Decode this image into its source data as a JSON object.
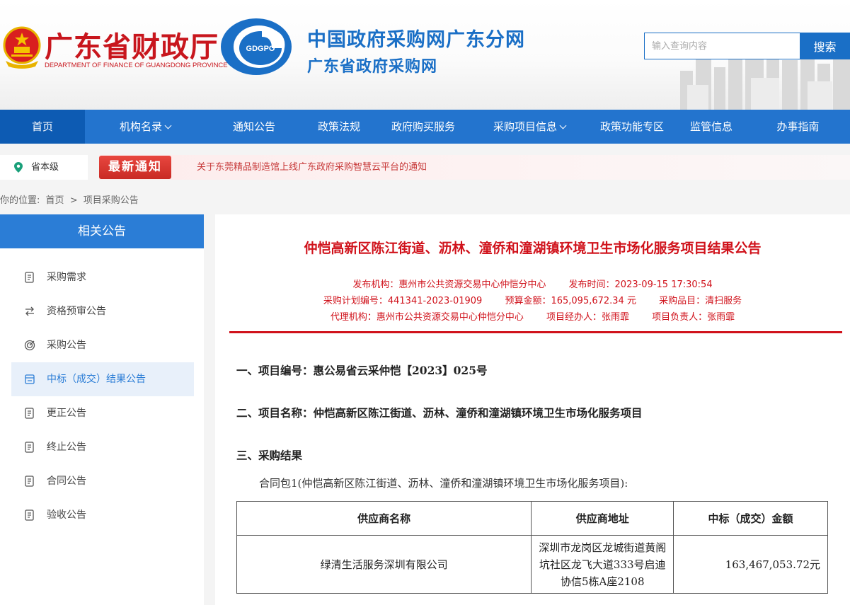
{
  "header": {
    "dept_name": "广东省财政厅",
    "dept_name_en": "DEPARTMENT OF FINANCE OF GUANGDONG PROVINCE",
    "logo_text": "GDGPO",
    "site_title": "中国政府采购网广东分网",
    "site_subtitle": "广东省政府采购网",
    "search": {
      "placeholder": "输入查询内容",
      "button_label": "搜索"
    }
  },
  "nav": {
    "items": [
      {
        "label": "首页",
        "active": true,
        "dropdown": false
      },
      {
        "label": "机构名录",
        "active": false,
        "dropdown": true
      },
      {
        "label": "通知公告",
        "active": false,
        "dropdown": false
      },
      {
        "label": "政策法规",
        "active": false,
        "dropdown": false
      },
      {
        "label": "政府购买服务",
        "active": false,
        "dropdown": false
      },
      {
        "label": "采购项目信息",
        "active": false,
        "dropdown": true
      },
      {
        "label": "政策功能专区",
        "active": false,
        "dropdown": false
      },
      {
        "label": "监管信息",
        "active": false,
        "dropdown": false
      },
      {
        "label": "办事指南",
        "active": false,
        "dropdown": false
      }
    ]
  },
  "notice": {
    "region": "省本级",
    "badge": "最新通知",
    "text": "关于东莞精品制造馆上线广东政府采购智慧云平台的通知"
  },
  "breadcrumb": {
    "prefix": "你的位置:",
    "home": "首页",
    "separator": ">",
    "current": "项目采购公告"
  },
  "sidebar": {
    "title": "相关公告",
    "items": [
      {
        "label": "采购需求",
        "icon": "document-list-icon",
        "active": false
      },
      {
        "label": "资格预审公告",
        "icon": "swap-arrows-icon",
        "active": false
      },
      {
        "label": "采购公告",
        "icon": "target-icon",
        "active": false
      },
      {
        "label": "中标（成交）结果公告",
        "icon": "document-result-icon",
        "active": true
      },
      {
        "label": "更正公告",
        "icon": "document-list-icon",
        "active": false
      },
      {
        "label": "终止公告",
        "icon": "document-list-icon",
        "active": false
      },
      {
        "label": "合同公告",
        "icon": "document-list-icon",
        "active": false
      },
      {
        "label": "验收公告",
        "icon": "document-list-icon",
        "active": false
      }
    ]
  },
  "doc": {
    "title": "仲恺高新区陈江街道、沥林、潼侨和潼湖镇环境卫生市场化服务项目结果公告",
    "meta": {
      "publisher": "发布机构：惠州市公共资源交易中心仲恺分中心",
      "publish_time": "发布时间：2023-09-15 17:30:54",
      "plan_no": "采购计划编号：441341-2023-01909",
      "budget": "预算金额：165,095,672.34 元",
      "category": "采购品目：清扫服务",
      "agency": "代理机构：惠州市公共资源交易中心仲恺分中心",
      "manager": "项目经办人：张雨霏",
      "leader": "项目负责人：张雨霏"
    },
    "section1": "一、项目编号：惠公易省云采仲恺【2023】025号",
    "section2": "二、项目名称：仲恺高新区陈江街道、沥林、潼侨和潼湖镇环境卫生市场化服务项目",
    "section3": "三、采购结果",
    "package_line": "合同包1(仲恺高新区陈江街道、沥林、潼侨和潼湖镇环境卫生市场化服务项目):",
    "table": {
      "headers": [
        "供应商名称",
        "供应商地址",
        "中标（成交）金额"
      ],
      "rows": [
        {
          "supplier": "绿清生活服务深圳有限公司",
          "address": "深圳市龙岗区龙城街道黄阁坑社区龙飞大道333号启迪协信5栋A座2108",
          "amount": "163,467,053.72元"
        }
      ]
    }
  },
  "colors": {
    "brand_blue": "#2374ce",
    "nav_active": "#0d5bb3",
    "title_red": "#d0121b",
    "dept_red": "#c8161d"
  }
}
